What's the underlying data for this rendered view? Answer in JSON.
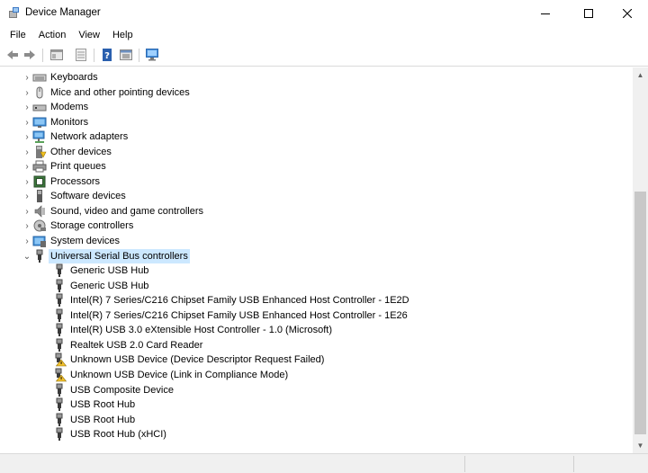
{
  "window": {
    "title": "Device Manager",
    "controls": {
      "minimize": "–",
      "maximize": "☐",
      "close": "✕"
    }
  },
  "menu": [
    "File",
    "Action",
    "View",
    "Help"
  ],
  "toolbar": {
    "buttons": [
      "back-icon",
      "forward-icon",
      "properties-view-icon",
      "show-hidden-icon",
      "help-icon",
      "update-driver-icon",
      "scan-hardware-icon"
    ]
  },
  "tree": {
    "categories": [
      {
        "label": "Keyboards",
        "icon": "keyboard-icon",
        "expanded": false
      },
      {
        "label": "Mice and other pointing devices",
        "icon": "mouse-icon",
        "expanded": false
      },
      {
        "label": "Modems",
        "icon": "modem-icon",
        "expanded": false
      },
      {
        "label": "Monitors",
        "icon": "monitor-icon",
        "expanded": false
      },
      {
        "label": "Network adapters",
        "icon": "network-adapter-icon",
        "expanded": false
      },
      {
        "label": "Other devices",
        "icon": "other-device-icon",
        "expanded": false
      },
      {
        "label": "Print queues",
        "icon": "printer-icon",
        "expanded": false
      },
      {
        "label": "Processors",
        "icon": "processor-icon",
        "expanded": false
      },
      {
        "label": "Software devices",
        "icon": "software-device-icon",
        "expanded": false
      },
      {
        "label": "Sound, video and game controllers",
        "icon": "speaker-icon",
        "expanded": false
      },
      {
        "label": "Storage controllers",
        "icon": "storage-controller-icon",
        "expanded": false
      },
      {
        "label": "System devices",
        "icon": "system-device-icon",
        "expanded": false
      },
      {
        "label": "Universal Serial Bus controllers",
        "icon": "usb-icon",
        "expanded": true,
        "selected": true
      }
    ],
    "usb_children": [
      {
        "label": "Generic USB Hub",
        "icon": "usb-icon"
      },
      {
        "label": "Generic USB Hub",
        "icon": "usb-icon"
      },
      {
        "label": "Intel(R) 7 Series/C216 Chipset Family USB Enhanced Host Controller - 1E2D",
        "icon": "usb-icon"
      },
      {
        "label": "Intel(R) 7 Series/C216 Chipset Family USB Enhanced Host Controller - 1E26",
        "icon": "usb-icon"
      },
      {
        "label": "Intel(R) USB 3.0 eXtensible Host Controller - 1.0 (Microsoft)",
        "icon": "usb-icon"
      },
      {
        "label": "Realtek USB 2.0 Card Reader",
        "icon": "usb-icon"
      },
      {
        "label": "Unknown USB Device (Device Descriptor Request Failed)",
        "icon": "usb-warning-icon"
      },
      {
        "label": "Unknown USB Device (Link in Compliance Mode)",
        "icon": "usb-warning-icon"
      },
      {
        "label": "USB Composite Device",
        "icon": "usb-icon"
      },
      {
        "label": "USB Root Hub",
        "icon": "usb-icon"
      },
      {
        "label": "USB Root Hub",
        "icon": "usb-icon"
      },
      {
        "label": "USB Root Hub (xHCI)",
        "icon": "usb-icon"
      }
    ]
  },
  "colors": {
    "selection": "#cce8ff",
    "scrollbar_track": "#f0f0f0",
    "scrollbar_thumb": "#c8c8c8"
  }
}
